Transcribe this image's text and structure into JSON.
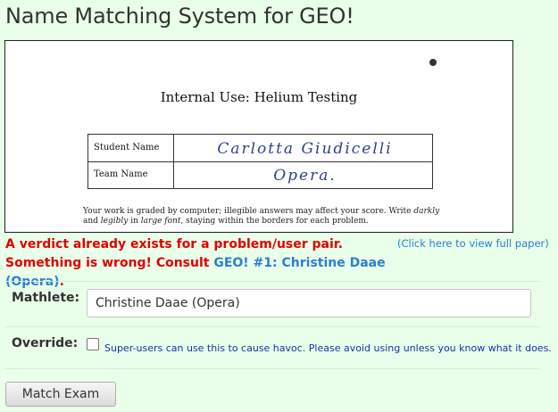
{
  "page": {
    "title": "Name Matching System for GEO!"
  },
  "scan": {
    "heading": "Internal Use: Helium Testing",
    "rows": [
      {
        "label": "Student Name",
        "handwritten": "Carlotta Giudicelli"
      },
      {
        "label": "Team Name",
        "handwritten": "Opera."
      }
    ],
    "note_part1": "Your work is graded by computer; illegible answers may affect your score. Write ",
    "note_darkly": "darkly",
    "note_and": " and ",
    "note_legibly": "legibly",
    "note_part2": " in ",
    "note_large_font": "large font",
    "note_part3": ", staying within the borders for each problem."
  },
  "view_full_paper": "(Click here to view full paper)",
  "verdict": {
    "message": "A verdict already exists for a problem/user pair. Something is wrong! Consult ",
    "link_text": "GEO! #1: Christine Daae (Opera)",
    "end": "."
  },
  "form": {
    "mathlete_label": "Mathlete:",
    "mathlete_value": "Christine Daae (Opera)",
    "override_label": "Override:",
    "override_checked": false,
    "override_help": "Super-users can use this to cause havoc. Please avoid using unless you know what it does.",
    "submit_label": "Match Exam"
  }
}
